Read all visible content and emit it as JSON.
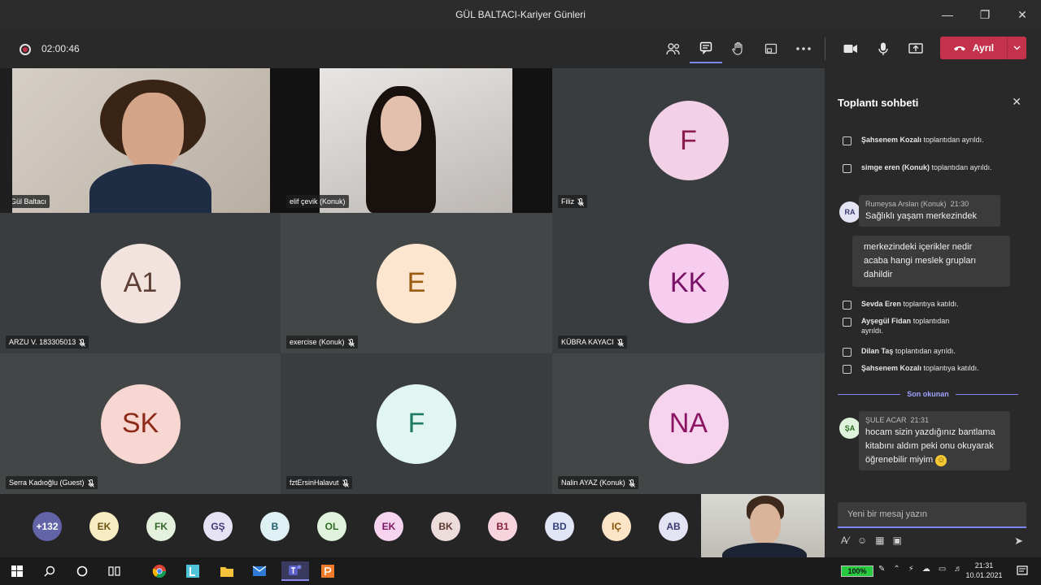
{
  "window": {
    "title": "GÜL BALTACI-Kariyer Günleri"
  },
  "toolbar": {
    "timer": "02:00:46",
    "leave_label": "Ayrıl"
  },
  "tiles": [
    {
      "label": "Gül Baltacı",
      "type": "video",
      "muted": false
    },
    {
      "label": "elif çevik (Konuk)",
      "type": "video",
      "muted": false
    },
    {
      "label": "Filiz",
      "initials": "F",
      "avatar_bg": "#f2d0e6",
      "avatar_fg": "#8b1a4f",
      "muted": true
    },
    {
      "label": "ARZU V. 183305013",
      "initials": "A1",
      "avatar_bg": "#f3e3df",
      "avatar_fg": "#5e3f35",
      "muted": true
    },
    {
      "label": "exercise (Konuk)",
      "initials": "E",
      "avatar_bg": "#fde6cf",
      "avatar_fg": "#9a5a10",
      "muted": true
    },
    {
      "label": "KÜBRA KAYACI",
      "initials": "KK",
      "avatar_bg": "#f6cdee",
      "avatar_fg": "#7a1166",
      "muted": true
    },
    {
      "label": "Serra Kadıoğlu (Guest)",
      "initials": "SK",
      "avatar_bg": "#f8d7d2",
      "avatar_fg": "#8c2a17",
      "muted": true
    },
    {
      "label": "fztErsinHalavut",
      "initials": "F",
      "avatar_bg": "#e2f6f1",
      "avatar_fg": "#1f7a64",
      "muted": true
    },
    {
      "label": "Nalin AYAZ (Konuk)",
      "initials": "NA",
      "avatar_bg": "#f7d4ed",
      "avatar_fg": "#8b1563",
      "muted": true
    }
  ],
  "strip": [
    {
      "initials": "+132",
      "bg": "#6264a7",
      "fg": "#ffffff"
    },
    {
      "initials": "EK",
      "bg": "#f7ecc2",
      "fg": "#6b5410"
    },
    {
      "initials": "FK",
      "bg": "#e3f1dd",
      "fg": "#35652a"
    },
    {
      "initials": "GŞ",
      "bg": "#e6e4f4",
      "fg": "#3e3a78"
    },
    {
      "initials": "B",
      "bg": "#def1f4",
      "fg": "#1e5b66"
    },
    {
      "initials": "OL",
      "bg": "#dff3dc",
      "fg": "#2d6a23"
    },
    {
      "initials": "EK",
      "bg": "#f6d4ef",
      "fg": "#7b1766"
    },
    {
      "initials": "BK",
      "bg": "#ecdcda",
      "fg": "#5e3a35"
    },
    {
      "initials": "B1",
      "bg": "#f7d3dd",
      "fg": "#85213a"
    },
    {
      "initials": "BD",
      "bg": "#e2e5f5",
      "fg": "#32407a"
    },
    {
      "initials": "IÇ",
      "bg": "#fbe5c6",
      "fg": "#8a5208"
    },
    {
      "initials": "AB",
      "bg": "#e3e3f3",
      "fg": "#3a3a72"
    }
  ],
  "chat": {
    "header": "Toplantı sohbeti",
    "sys_top": [
      {
        "name": "Şahsenem Kozalı",
        "text": "toplantıdan ayrıldı."
      },
      {
        "name": "simge eren (Konuk)",
        "text": "toplantıdan ayrıldı."
      }
    ],
    "msg1": {
      "initials": "RA",
      "author": "Rumeysa Arslan (Konuk)",
      "time": "21:30",
      "line1": "Sağlıklı yaşam merkezindek",
      "line2": "merkezindeki içerikler nedir acaba hangi meslek grupları dahildir"
    },
    "sys_mid": [
      {
        "name": "Sevda Eren",
        "text": "toplantıya katıldı."
      },
      {
        "name": "Ayşegül Fidan",
        "text": "toplantıdan ayrıldı."
      },
      {
        "name": "Dilan Taş",
        "text": "toplantıdan ayrıldı."
      },
      {
        "name": "Şahsenem Kozalı",
        "text": "toplantıya katıldı."
      }
    ],
    "unread_label": "Son okunan",
    "msg2": {
      "initials": "ŞA",
      "author": "ŞULE ACAR",
      "time": "21:31",
      "text": "hocam sizin yazdığınız bantlama kitabını aldım peki onu okuyarak öğrenebilir miyim"
    },
    "composer_placeholder": "Yeni bir mesaj yazın"
  },
  "taskbar": {
    "battery": "100%",
    "time": "21:31",
    "date": "10.01.2021"
  }
}
